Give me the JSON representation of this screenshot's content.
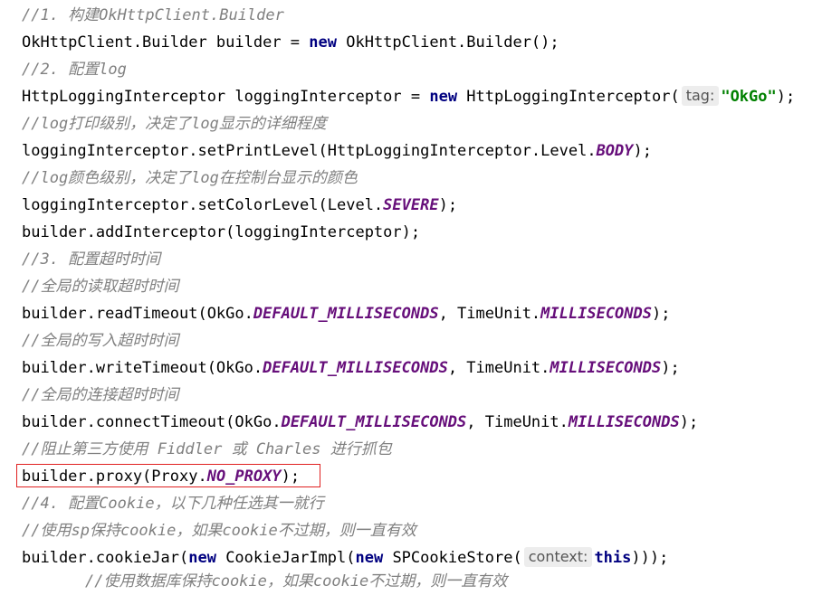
{
  "code": {
    "l1_comment": "//1. 构建OkHttpClient.Builder",
    "l2_a": "OkHttpClient.Builder builder = ",
    "l2_kw": "new",
    "l2_b": " OkHttpClient.Builder();",
    "l3_comment": "//2. 配置log",
    "l4_a": "HttpLoggingInterceptor loggingInterceptor = ",
    "l4_kw": "new",
    "l4_b": " HttpLoggingInterceptor(",
    "l4_hint": "tag:",
    "l4_str": "\"OkGo\"",
    "l4_c": ");",
    "l5_comment": "//log打印级别，决定了log显示的详细程度",
    "l6_a": "loggingInterceptor.setPrintLevel(HttpLoggingInterceptor.Level.",
    "l6_field": "BODY",
    "l6_b": ");",
    "l7_comment": "//log颜色级别，决定了log在控制台显示的颜色",
    "l8_a": "loggingInterceptor.setColorLevel(Level.",
    "l8_field": "SEVERE",
    "l8_b": ");",
    "l9": "builder.addInterceptor(loggingInterceptor);",
    "l10_comment": "//3. 配置超时时间",
    "l11_comment": "//全局的读取超时时间",
    "l12_a": "builder.readTimeout(OkGo.",
    "l12_field1": "DEFAULT_MILLISECONDS",
    "l12_b": ", TimeUnit.",
    "l12_field2": "MILLISECONDS",
    "l12_c": ");",
    "l13_comment": "//全局的写入超时时间",
    "l14_a": "builder.writeTimeout(OkGo.",
    "l14_field1": "DEFAULT_MILLISECONDS",
    "l14_b": ", TimeUnit.",
    "l14_field2": "MILLISECONDS",
    "l14_c": ");",
    "l15_comment": "//全局的连接超时时间",
    "l16_a": "builder.connectTimeout(OkGo.",
    "l16_field1": "DEFAULT_MILLISECONDS",
    "l16_b": ", TimeUnit.",
    "l16_field2": "MILLISECONDS",
    "l16_c": ");",
    "l17_comment": "//阻止第三方使用 Fiddler 或 Charles 进行抓包",
    "l18_a": "builder.proxy(Proxy.",
    "l18_field": "NO_PROXY",
    "l18_b": ");",
    "l19_comment": "//4. 配置Cookie，以下几种任选其一就行",
    "l20_comment": "//使用sp保持cookie，如果cookie不过期，则一直有效",
    "l21_a": "builder.cookieJar(",
    "l21_kw1": "new",
    "l21_b": " CookieJarImpl(",
    "l21_kw2": "new",
    "l21_c": " SPCookieStore(",
    "l21_hint": "context:",
    "l21_kw3": "this",
    "l21_d": ")));",
    "l22_comment": "//使用数据库保持cookie，如果cookie不过期，则一直有效"
  },
  "colors": {
    "comment": "#808080",
    "keyword": "#000080",
    "static_field": "#660e7a",
    "string": "#008000",
    "highlight_border": "#e02020"
  }
}
